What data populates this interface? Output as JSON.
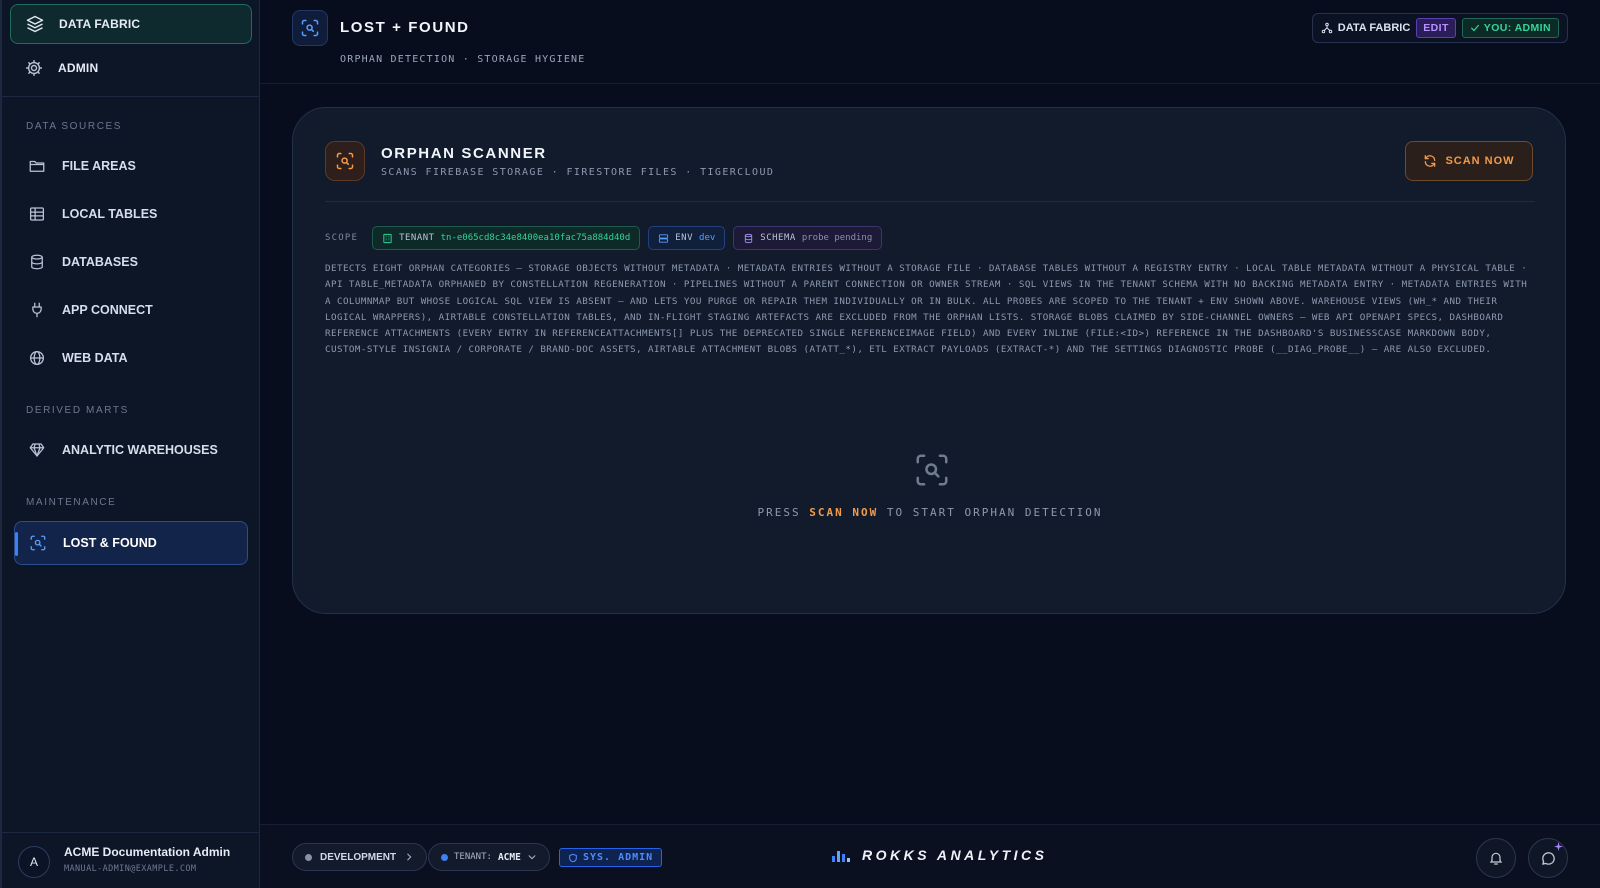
{
  "sidebar": {
    "top_items": [
      {
        "label": "DATA FABRIC",
        "icon": "layers-icon"
      },
      {
        "label": "ADMIN",
        "icon": "gear-icon"
      }
    ],
    "sections": [
      {
        "title": "DATA SOURCES"
      },
      {
        "title": "DERIVED MARTS"
      },
      {
        "title": "MAINTENANCE"
      }
    ],
    "items": [
      {
        "label": "FILE AREAS",
        "icon": "folder-icon"
      },
      {
        "label": "LOCAL TABLES",
        "icon": "table-icon"
      },
      {
        "label": "DATABASES",
        "icon": "database-icon"
      },
      {
        "label": "APP CONNECT",
        "icon": "plug-icon"
      },
      {
        "label": "WEB DATA",
        "icon": "globe-icon"
      },
      {
        "label": "ANALYTIC WAREHOUSES",
        "icon": "gem-icon"
      },
      {
        "label": "LOST & FOUND",
        "icon": "scan-search-icon"
      }
    ],
    "user": {
      "initial": "A",
      "name": "ACME Documentation Admin",
      "email": "MANUAL-ADMIN@EXAMPLE.COM"
    }
  },
  "header": {
    "title": "LOST + FOUND",
    "subtitle": "ORPHAN DETECTION · STORAGE HYGIENE",
    "badges": {
      "fabric": "DATA FABRIC",
      "edit": "EDIT",
      "you": "YOU: ADMIN"
    }
  },
  "card": {
    "title": "ORPHAN SCANNER",
    "subtitle": "SCANS FIREBASE STORAGE · FIRESTORE FILES · TIGERCLOUD",
    "scan_button": "SCAN NOW",
    "scope": {
      "label": "SCOPE",
      "tenant_key": "TENANT",
      "tenant_value": "tn-e065cd8c34e8400ea10fac75a884d40d",
      "env_key": "ENV",
      "env_value": "dev",
      "schema_key": "SCHEMA",
      "schema_value": "probe pending"
    },
    "description": "DETECTS EIGHT ORPHAN CATEGORIES — STORAGE OBJECTS WITHOUT METADATA · METADATA ENTRIES WITHOUT A STORAGE FILE · DATABASE TABLES WITHOUT A REGISTRY ENTRY · LOCAL TABLE METADATA WITHOUT A PHYSICAL TABLE · API TABLE_METADATA ORPHANED BY CONSTELLATION REGENERATION · PIPELINES WITHOUT A PARENT CONNECTION OR OWNER STREAM · SQL VIEWS IN THE TENANT SCHEMA WITH NO BACKING METADATA ENTRY · METADATA ENTRIES WITH A COLUMNMAP BUT WHOSE LOGICAL SQL VIEW IS ABSENT — AND LETS YOU PURGE OR REPAIR THEM INDIVIDUALLY OR IN BULK. ALL PROBES ARE SCOPED TO THE TENANT + ENV SHOWN ABOVE. WAREHOUSE VIEWS (WH_* AND THEIR LOGICAL WRAPPERS), AIRTABLE CONSTELLATION TABLES, AND IN-FLIGHT STAGING ARTEFACTS ARE EXCLUDED FROM THE ORPHAN LISTS. STORAGE BLOBS CLAIMED BY SIDE-CHANNEL OWNERS — WEB API OPENAPI SPECS, DASHBOARD REFERENCE ATTACHMENTS (EVERY ENTRY IN REFERENCEATTACHMENTS[] PLUS THE DEPRECATED SINGLE REFERENCEIMAGE FIELD) AND EVERY INLINE (FILE:<ID>) REFERENCE IN THE DASHBOARD'S BUSINESSCASE MARKDOWN BODY, CUSTOM-STYLE INSIGNIA / CORPORATE / BRAND-DOC ASSETS, AIRTABLE ATTACHMENT BLOBS (ATATT_*), ETL EXTRACT PAYLOADS (EXTRACT-*) AND THE SETTINGS DIAGNOSTIC PROBE (__DIAG_PROBE__) — ARE ALSO EXCLUDED.",
    "empty": {
      "prefix": "PRESS",
      "highlight": "SCAN NOW",
      "suffix": "TO START ORPHAN DETECTION"
    }
  },
  "footer": {
    "env": "DEVELOPMENT",
    "tenant_key": "TENANT:",
    "tenant_value": "ACME",
    "role": "SYS. ADMIN",
    "brand": "ROKKS ANALYTICS"
  },
  "colors": {
    "accent_blue": "#3b82f6",
    "accent_orange": "#f39b4a",
    "accent_green": "#33d49b",
    "accent_purple": "#b592ff"
  }
}
